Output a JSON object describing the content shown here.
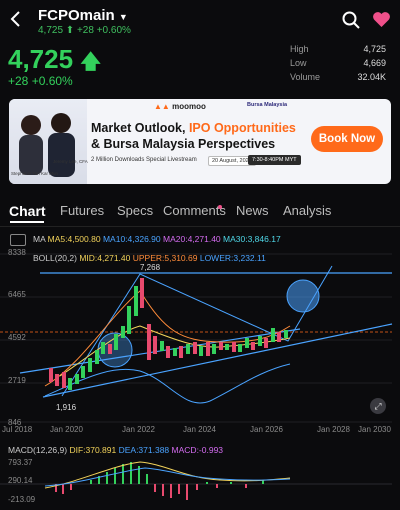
{
  "header": {
    "title": "FCPOmain",
    "subline": "4,725 ⬆ +28 +0.60%"
  },
  "quote": {
    "price": "4,725",
    "change": "+28 +0.60%",
    "stats": [
      {
        "label": "High",
        "value": "4,725"
      },
      {
        "label": "Low",
        "value": "4,669"
      },
      {
        "label": "Volume",
        "value": "32.04K"
      }
    ]
  },
  "banner": {
    "brand": "moomoo",
    "partner": "Bursa Malaysia",
    "headline_1a": "Market Outlook, ",
    "headline_1b": "IPO Opportunities",
    "headline_2": "& Bursa Malaysia Perspectives",
    "subtext": "2 Million Downloads Special Livestream",
    "date": "20 August, 2026",
    "time": "7:30-8:40PM MYT",
    "button": "Book Now",
    "speaker_1": "Stephanie Tan Kar Mun",
    "speaker_2": "Jeremy Lee, CFA"
  },
  "tabs": [
    {
      "label": "Chart",
      "active": true
    },
    {
      "label": "Futures"
    },
    {
      "label": "Specs"
    },
    {
      "label": "Comments"
    },
    {
      "label": "News"
    },
    {
      "label": "Analysis"
    }
  ],
  "ma_row": {
    "label": "MA",
    "ma5": "MA5:4,500.80",
    "ma10": "MA10:4,326.90",
    "ma20": "MA20:4,271.40",
    "ma30": "MA30:3,846.17"
  },
  "boll_row": {
    "label": "BOLL(20,2)",
    "mid": "MID:4,271.40",
    "upper": "UPPER:5,310.69",
    "lower": "LOWER:3,232.11"
  },
  "price_axis": [
    "8338",
    "6465",
    "4592",
    "2719",
    "846"
  ],
  "time_axis": [
    "Jul 2018",
    "Jan 2020",
    "Jan 2022",
    "Jan 2024",
    "Jan 2026",
    "Jan 2028",
    "Jan 2030"
  ],
  "annotations": {
    "high": "7,268",
    "low": "1,916"
  },
  "macd_row": {
    "label": "MACD(12,26,9)",
    "dif": "DIF:370.891",
    "dea": "DEA:371.388",
    "macd": "MACD:-0.993"
  },
  "macd_axis": [
    "793.37",
    "290.14",
    "-213.09"
  ],
  "colors": {
    "up": "#33d15c",
    "down": "#e84a6e",
    "accent": "#ff6a1a",
    "ma5": "#f2d35b",
    "ma10": "#4aa3ff",
    "ma20": "#d46cf0",
    "ma30": "#4fd6e6"
  }
}
